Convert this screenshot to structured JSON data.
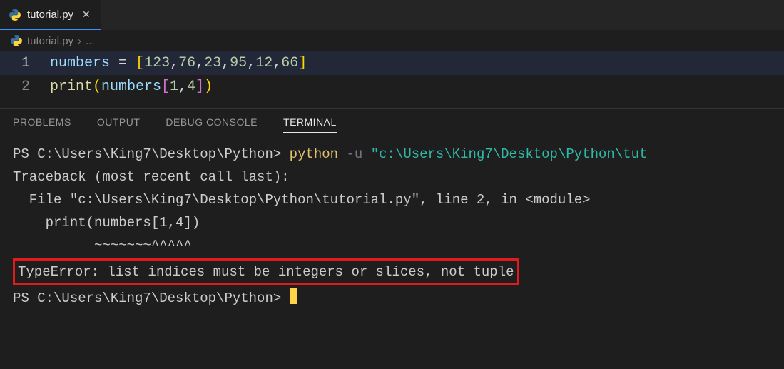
{
  "tab": {
    "filename": "tutorial.py"
  },
  "breadcrumb": {
    "filename": "tutorial.py",
    "sep": "›",
    "more": "..."
  },
  "editor": {
    "lines": [
      {
        "n": "1",
        "tokens": [
          "numbers",
          " ",
          "=",
          " ",
          "[",
          "123",
          ",",
          "76",
          ",",
          "23",
          ",",
          "95",
          ",",
          "12",
          ",",
          "66",
          "]"
        ]
      },
      {
        "n": "2",
        "tokens": [
          "print",
          "(",
          "numbers",
          "[",
          "1",
          ",",
          "4",
          "]",
          ")"
        ]
      }
    ]
  },
  "panel": {
    "tabs": {
      "problems": "PROBLEMS",
      "output": "OUTPUT",
      "debug": "DEBUG CONSOLE",
      "terminal": "TERMINAL"
    }
  },
  "terminal": {
    "ps": "PS C:\\Users\\King7\\Desktop\\Python> ",
    "cmd": "python",
    "flag": "-u",
    "arg": "\"c:\\Users\\King7\\Desktop\\Python\\tut",
    "trace0": "Traceback (most recent call last):",
    "trace1": "  File \"c:\\Users\\King7\\Desktop\\Python\\tutorial.py\", line 2, in <module>",
    "trace2": "    print(numbers[1,4])",
    "trace3": "          ~~~~~~~^^^^^",
    "error": "TypeError: list indices must be integers or slices, not tuple",
    "ps2": "PS C:\\Users\\King7\\Desktop\\Python> "
  }
}
